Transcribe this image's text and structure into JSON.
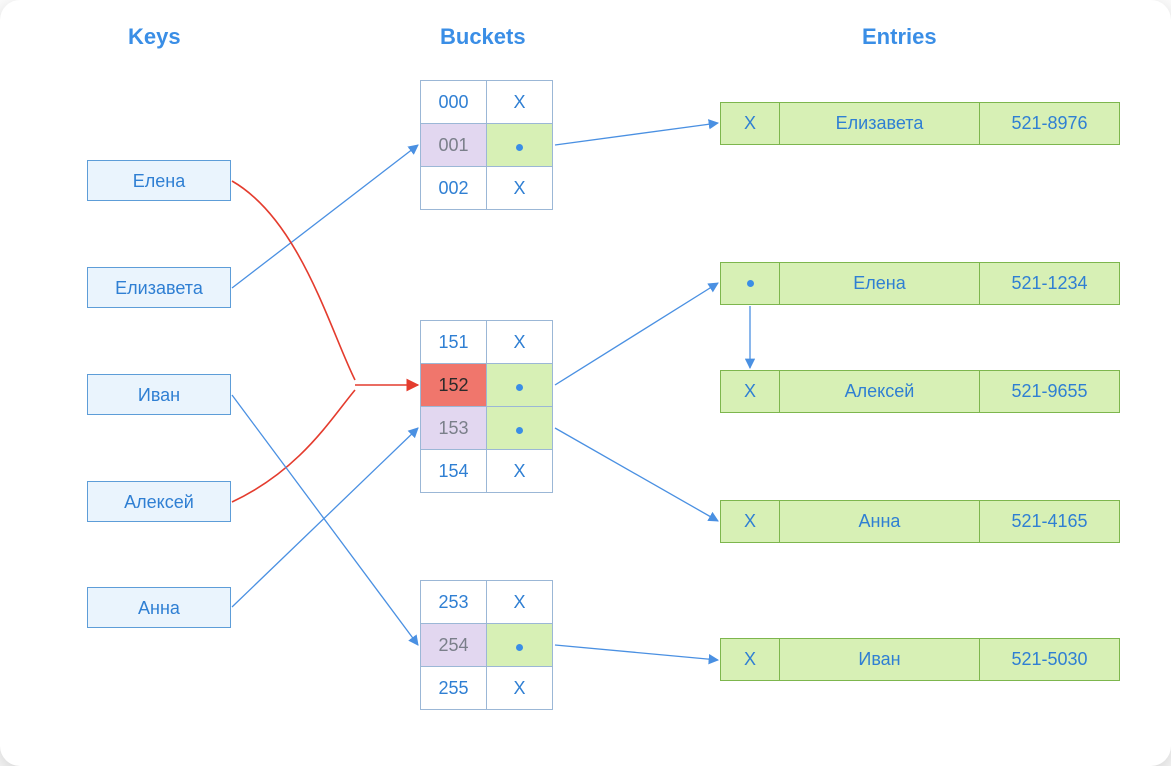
{
  "headings": {
    "keys": "Keys",
    "buckets": "Buckets",
    "entries": "Entries"
  },
  "keys": [
    "Елена",
    "Елизавета",
    "Иван",
    "Алексей",
    "Анна"
  ],
  "bucketGroups": [
    {
      "rows": [
        {
          "idx": "000",
          "idxStyle": "",
          "ptr": "X",
          "ptrStyle": ""
        },
        {
          "idx": "001",
          "idxStyle": "idx-purple",
          "ptr": "dot",
          "ptrStyle": "ptr"
        },
        {
          "idx": "002",
          "idxStyle": "",
          "ptr": "X",
          "ptrStyle": ""
        }
      ]
    },
    {
      "rows": [
        {
          "idx": "151",
          "idxStyle": "",
          "ptr": "X",
          "ptrStyle": ""
        },
        {
          "idx": "152",
          "idxStyle": "idx-red",
          "ptr": "dot",
          "ptrStyle": "ptr"
        },
        {
          "idx": "153",
          "idxStyle": "idx-purple",
          "ptr": "dot",
          "ptrStyle": "ptr"
        },
        {
          "idx": "154",
          "idxStyle": "",
          "ptr": "X",
          "ptrStyle": ""
        }
      ]
    },
    {
      "rows": [
        {
          "idx": "253",
          "idxStyle": "",
          "ptr": "X",
          "ptrStyle": ""
        },
        {
          "idx": "254",
          "idxStyle": "idx-purple",
          "ptr": "dot",
          "ptrStyle": "ptr"
        },
        {
          "idx": "255",
          "idxStyle": "",
          "ptr": "X",
          "ptrStyle": ""
        }
      ]
    }
  ],
  "entries": [
    {
      "next": "X",
      "name": "Елизавета",
      "phone": "521-8976"
    },
    {
      "next": "dot",
      "name": "Елена",
      "phone": "521-1234"
    },
    {
      "next": "X",
      "name": "Алексей",
      "phone": "521-9655"
    },
    {
      "next": "X",
      "name": "Анна",
      "phone": "521-4165"
    },
    {
      "next": "X",
      "name": "Иван",
      "phone": "521-5030"
    }
  ]
}
